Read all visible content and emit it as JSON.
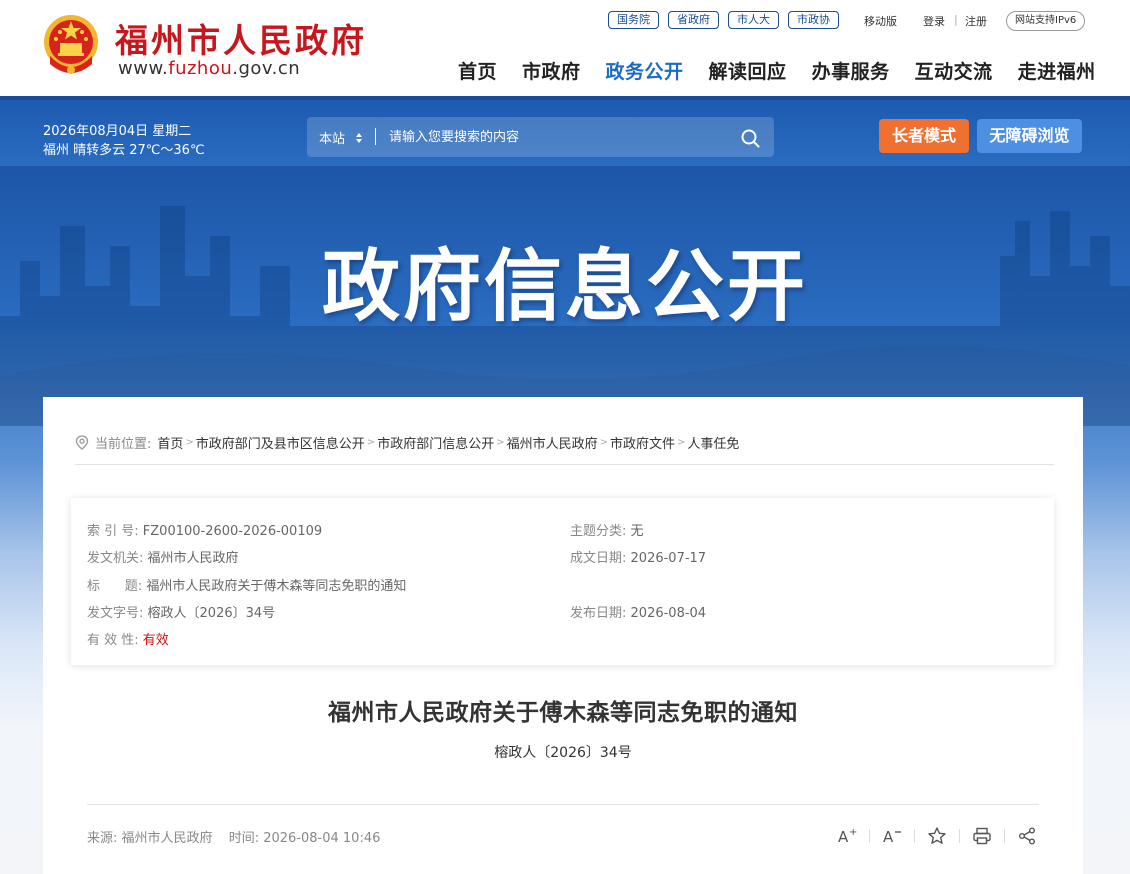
{
  "header": {
    "site_name": "福州市人民政府",
    "site_url_prefix": "www.",
    "site_url_domain": "fuzhou",
    "site_url_suffix": ".gov.cn",
    "quick_links": [
      "国务院",
      "省政府",
      "市人大",
      "市政协"
    ],
    "mobile_label": "移动版",
    "login_label": "登录",
    "divider": "|",
    "register_label": "注册",
    "ipv6_label": "网站支持IPv6",
    "nav": [
      {
        "label": "首页",
        "active": false
      },
      {
        "label": "市政府",
        "active": false
      },
      {
        "label": "政务公开",
        "active": true
      },
      {
        "label": "解读回应",
        "active": false
      },
      {
        "label": "办事服务",
        "active": false
      },
      {
        "label": "互动交流",
        "active": false
      },
      {
        "label": "走进福州",
        "active": false
      }
    ]
  },
  "infobar": {
    "date": "2026年08月04日 星期二",
    "weather": "福州 晴转多云 27℃～36℃",
    "search_scope": "本站",
    "search_placeholder": "请输入您要搜索的内容",
    "elder_mode": "长者模式",
    "accessible": "无障碍浏览"
  },
  "banner": {
    "title": "政府信息公开"
  },
  "breadcrumb": {
    "label": "当前位置:",
    "items": [
      "首页",
      "市政府部门及县市区信息公开",
      "市政府部门信息公开",
      "福州市人民政府",
      "市政府文件",
      "人事任免"
    ]
  },
  "meta": {
    "index_label": "索 引 号:",
    "index_value": "FZ00100-2600-2026-00109",
    "topic_label": "主题分类:",
    "topic_value": "无",
    "issuer_label": "发文机关:",
    "issuer_value": "福州市人民政府",
    "written_date_label": "成文日期:",
    "written_date_value": "2026-07-17",
    "title_label": "标      题:",
    "title_value": "福州市人民政府关于傅木森等同志免职的通知",
    "doc_no_label": "发文字号:",
    "doc_no_value": "榕政人〔2026〕34号",
    "publish_date_label": "发布日期:",
    "publish_date_value": "2026-08-04",
    "validity_label": "有 效 性:",
    "validity_value": "有效"
  },
  "document": {
    "title": "福州市人民政府关于傅木森等同志免职的通知",
    "number": "榕政人〔2026〕34号",
    "source_label": "来源:",
    "source_value": "福州市人民政府",
    "time_label": "时间:",
    "time_value": "2026-08-04 10:46"
  },
  "colors": {
    "brand_red": "#c8161d",
    "nav_active": "#1a6bc3",
    "bar_blue": "#2a6cc0",
    "elder_orange": "#f07030",
    "access_blue": "#4d8fe0",
    "valid_red": "#d01010"
  }
}
